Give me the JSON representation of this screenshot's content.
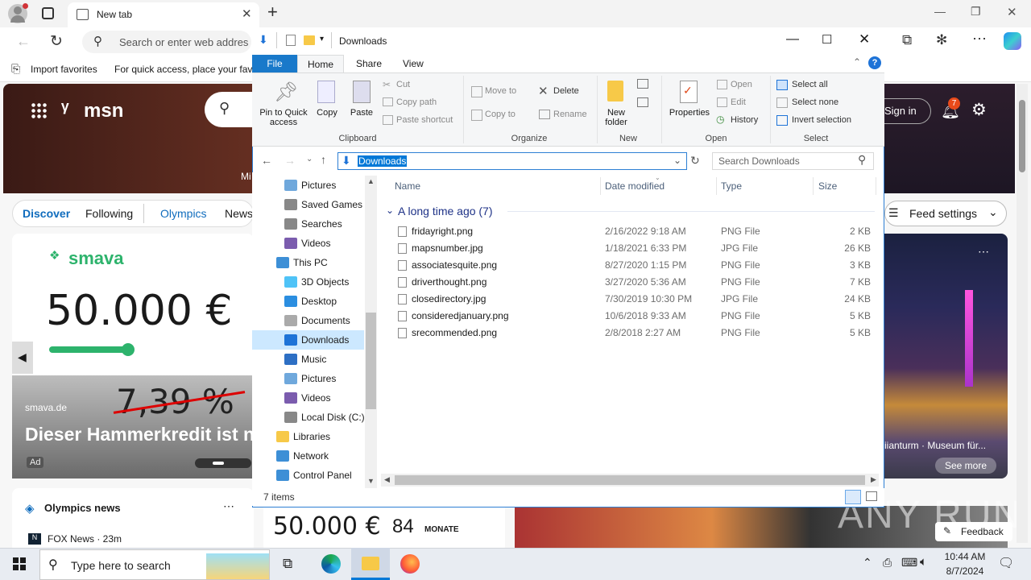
{
  "browser": {
    "tab_title": "New tab",
    "omnibox_placeholder": "Search or enter web addres",
    "favorites": {
      "import_label": "Import favorites",
      "hint_text": "For quick access, place your favo"
    }
  },
  "msn": {
    "brand": "msn",
    "sign_in": "Sign in",
    "notif_count": "7",
    "mi_text": "Mi",
    "nav_tabs": [
      "Discover",
      "Following",
      "Olympics",
      "News"
    ],
    "feed_settings": "Feed settings",
    "ad": {
      "brand": "smava",
      "amount": "50.000 €",
      "crossed_rate": "7,39 %",
      "source": "smava.de",
      "headline": "Dieser Hammerkredit ist n",
      "ad_badge": "Ad"
    },
    "right_card": {
      "caption": "iianturm · Museum für...",
      "see_more": "See more"
    },
    "olympics_card": {
      "title": "Olympics news",
      "source": "FOX News · 23m"
    },
    "mid_card": {
      "amount": "50.000 €",
      "months": "84",
      "months_label": "MONATE"
    },
    "feedback": "Feedback",
    "watermark": "ANY RUN"
  },
  "explorer": {
    "title": "Downloads",
    "ribbon_tabs": [
      "File",
      "Home",
      "Share",
      "View"
    ],
    "clipboard": {
      "pin": "Pin to Quick access",
      "copy": "Copy",
      "paste": "Paste",
      "cut": "Cut",
      "copy_path": "Copy path",
      "paste_shortcut": "Paste shortcut",
      "group": "Clipboard"
    },
    "organize": {
      "move_to": "Move to",
      "copy_to": "Copy to",
      "delete": "Delete",
      "rename": "Rename",
      "group": "Organize"
    },
    "new": {
      "new_folder": "New folder",
      "group": "New"
    },
    "open": {
      "properties": "Properties",
      "open": "Open",
      "edit": "Edit",
      "history": "History",
      "group": "Open"
    },
    "select": {
      "select_all": "Select all",
      "select_none": "Select none",
      "invert": "Invert selection",
      "group": "Select"
    },
    "path": "Downloads",
    "search_placeholder": "Search Downloads",
    "nav_items": [
      {
        "label": "Pictures"
      },
      {
        "label": "Saved Games"
      },
      {
        "label": "Searches"
      },
      {
        "label": "Videos"
      },
      {
        "label": "This PC"
      },
      {
        "label": "3D Objects"
      },
      {
        "label": "Desktop"
      },
      {
        "label": "Documents"
      },
      {
        "label": "Downloads"
      },
      {
        "label": "Music"
      },
      {
        "label": "Pictures"
      },
      {
        "label": "Videos"
      },
      {
        "label": "Local Disk (C:)"
      },
      {
        "label": "Libraries"
      },
      {
        "label": "Network"
      },
      {
        "label": "Control Panel"
      }
    ],
    "columns": {
      "name": "Name",
      "date": "Date modified",
      "type": "Type",
      "size": "Size"
    },
    "group_header": "A long time ago (7)",
    "files": [
      {
        "name": "fridayright.png",
        "date": "2/16/2022 9:18 AM",
        "type": "PNG File",
        "size": "2 KB"
      },
      {
        "name": "mapsnumber.jpg",
        "date": "1/18/2021 6:33 PM",
        "type": "JPG File",
        "size": "26 KB"
      },
      {
        "name": "associatesquite.png",
        "date": "8/27/2020 1:15 PM",
        "type": "PNG File",
        "size": "3 KB"
      },
      {
        "name": "driverthought.png",
        "date": "3/27/2020 5:36 AM",
        "type": "PNG File",
        "size": "7 KB"
      },
      {
        "name": "closedirectory.jpg",
        "date": "7/30/2019 10:30 PM",
        "type": "JPG File",
        "size": "24 KB"
      },
      {
        "name": "consideredjanuary.png",
        "date": "10/6/2018 9:33 AM",
        "type": "PNG File",
        "size": "5 KB"
      },
      {
        "name": "srecommended.png",
        "date": "2/8/2018 2:27 AM",
        "type": "PNG File",
        "size": "5 KB"
      }
    ],
    "status": "7 items"
  },
  "taskbar": {
    "search_placeholder": "Type here to search",
    "time": "10:44 AM",
    "date": "8/7/2024"
  }
}
